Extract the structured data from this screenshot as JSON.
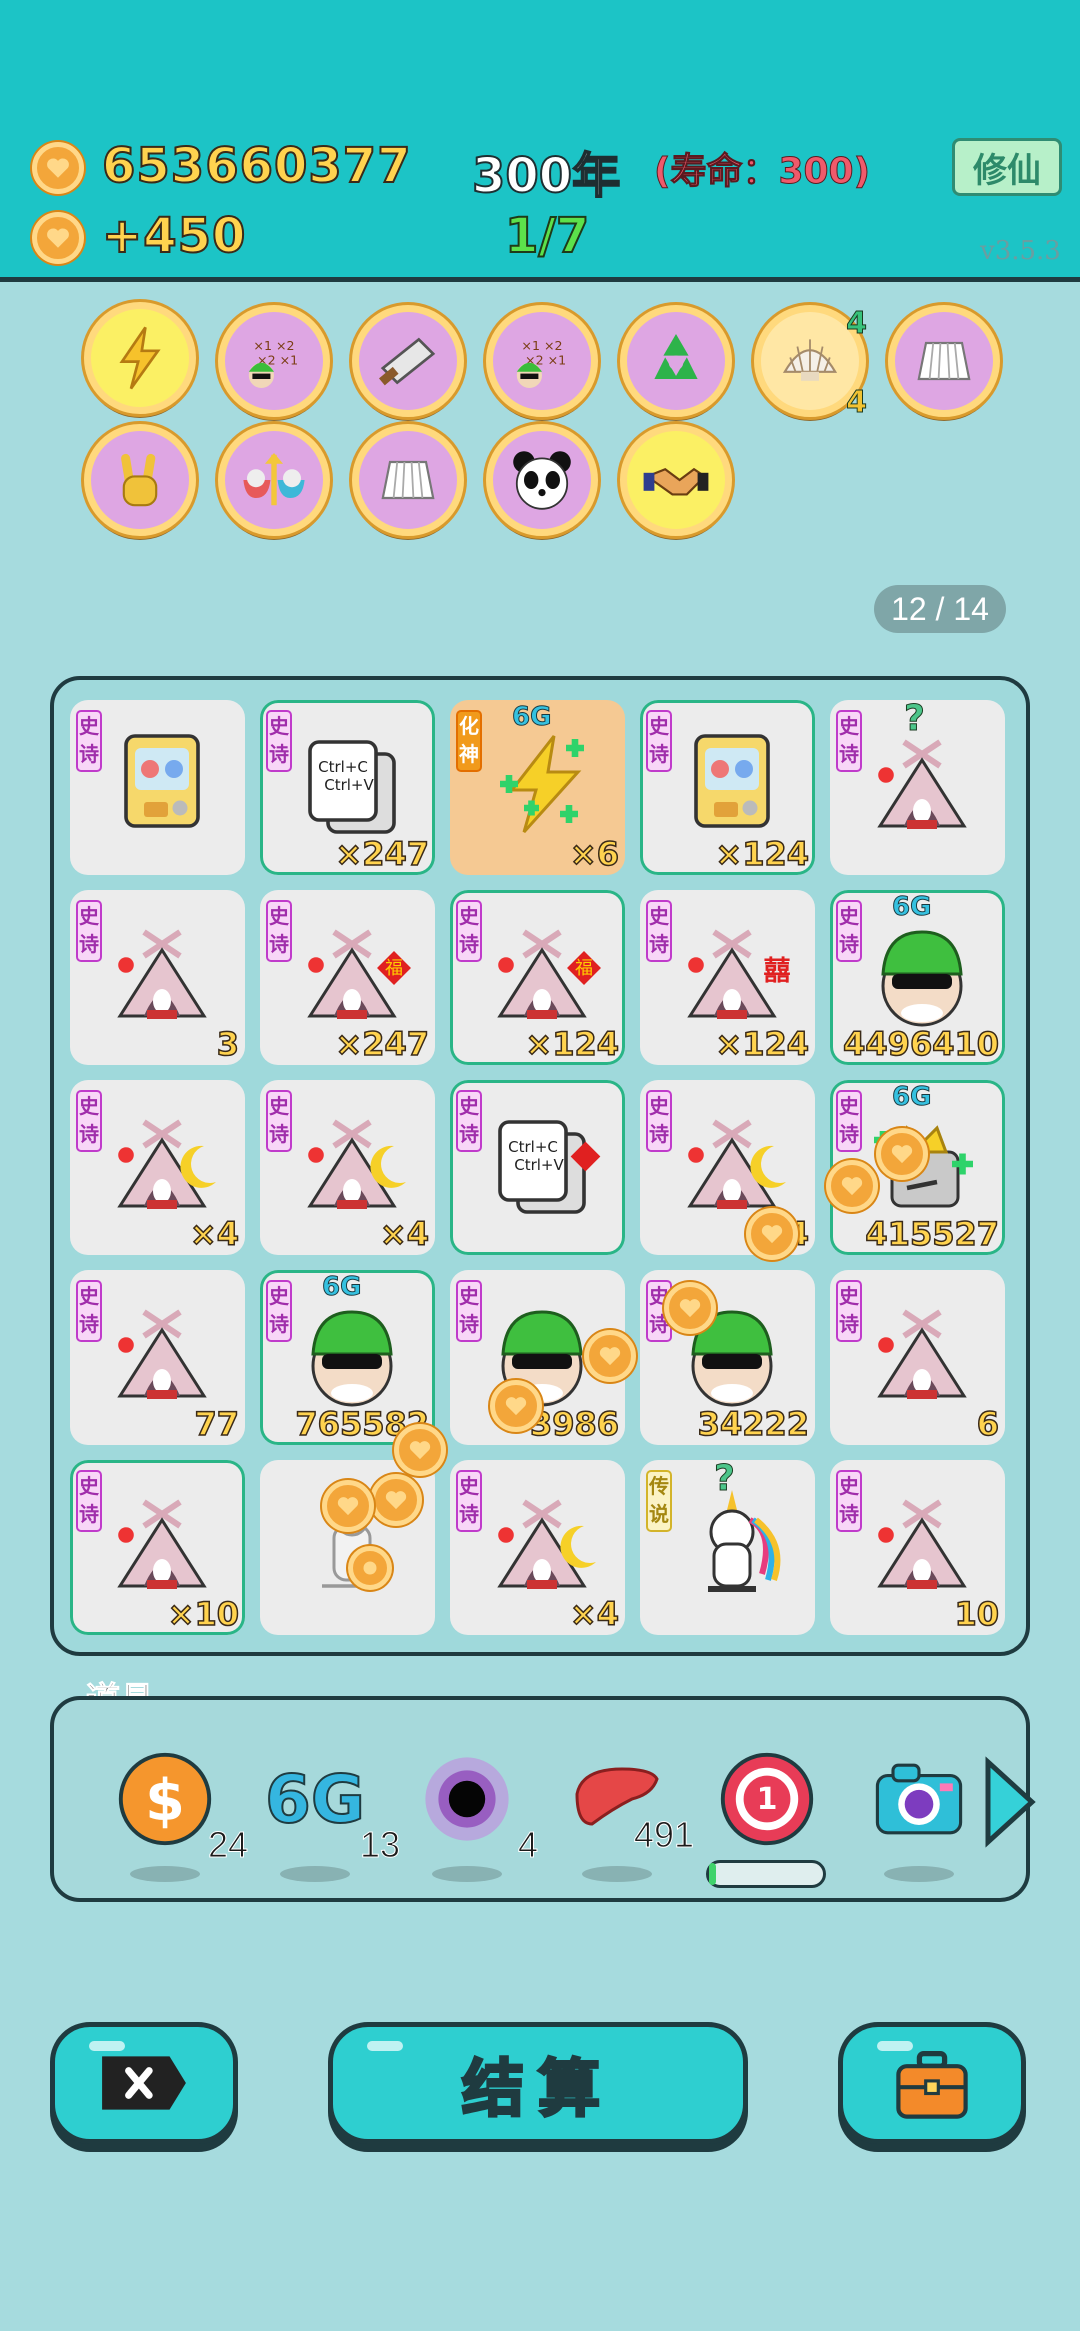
{
  "header": {
    "coins": "653660377",
    "income": "+450",
    "year": "300年",
    "lifespan": "(寿命：300)",
    "progress": "1/7",
    "cultivate_label": "修仙",
    "version": "v3.5.3"
  },
  "badges": [
    {
      "name": "lightning-icon",
      "count": ""
    },
    {
      "name": "multiply-formula-icon",
      "count": ""
    },
    {
      "name": "cleaver-icon",
      "count": ""
    },
    {
      "name": "multiply-formula-icon-2",
      "count": ""
    },
    {
      "name": "recycle-icon",
      "count": ""
    },
    {
      "name": "shell-icon",
      "count_top": "4",
      "count_bottom": "4"
    },
    {
      "name": "skirt-icon",
      "count": ""
    },
    {
      "name": "rock-hand-icon",
      "count": ""
    },
    {
      "name": "bowls-arrow-icon",
      "count": ""
    },
    {
      "name": "skirt-icon-2",
      "count": ""
    },
    {
      "name": "panda-icon",
      "count": ""
    },
    {
      "name": "handshake-icon",
      "count": ""
    }
  ],
  "page_indicator": "12 / 14",
  "board": {
    "cells": [
      {
        "tag": "史诗",
        "icon": "gashapon",
        "count": "",
        "gen": "",
        "green": false
      },
      {
        "tag": "史诗",
        "icon": "copy-paste",
        "count": "×247",
        "gen": "",
        "green": true
      },
      {
        "tag": "化神",
        "icon": "lightning-plus",
        "count": "×6",
        "gen": "6G",
        "green": false,
        "orange": true
      },
      {
        "tag": "史诗",
        "icon": "gashapon",
        "count": "×124",
        "gen": "",
        "green": true
      },
      {
        "tag": "史诗",
        "icon": "rabbit-tent",
        "count": "",
        "gen": "",
        "question": "?",
        "green": false
      },
      {
        "tag": "史诗",
        "icon": "rabbit-tent",
        "count": "3",
        "gen": "",
        "green": false
      },
      {
        "tag": "史诗",
        "icon": "rabbit-tent-fu",
        "count": "×247",
        "gen": "",
        "green": false
      },
      {
        "tag": "史诗",
        "icon": "rabbit-tent-fu",
        "count": "×124",
        "gen": "",
        "green": true
      },
      {
        "tag": "史诗",
        "icon": "rabbit-tent-xi",
        "count": "×124",
        "gen": "",
        "green": false
      },
      {
        "tag": "史诗",
        "icon": "green-hat-man",
        "count": "4496410",
        "gen": "6G",
        "green": true
      },
      {
        "tag": "史诗",
        "icon": "rabbit-tent-moon",
        "count": "×4",
        "gen": "",
        "green": false
      },
      {
        "tag": "史诗",
        "icon": "rabbit-tent-moon",
        "count": "×4",
        "gen": "",
        "green": false
      },
      {
        "tag": "史诗",
        "icon": "copy-paste-fu",
        "count": "",
        "gen": "",
        "green": true
      },
      {
        "tag": "史诗",
        "icon": "rabbit-tent-moon",
        "count": "4",
        "gen": "",
        "green": false
      },
      {
        "tag": "史诗",
        "icon": "crowned-block",
        "count": "415527",
        "gen": "6G",
        "green": true
      },
      {
        "tag": "史诗",
        "icon": "rabbit-tent",
        "count": "77",
        "gen": "",
        "green": false
      },
      {
        "tag": "史诗",
        "icon": "green-hat-man",
        "count": "765582",
        "gen": "6G",
        "green": true
      },
      {
        "tag": "史诗",
        "icon": "green-hat-man",
        "count": "3986",
        "gen": "",
        "green": false
      },
      {
        "tag": "史诗",
        "icon": "green-hat-man",
        "count": "34222",
        "gen": "",
        "green": false
      },
      {
        "tag": "史诗",
        "icon": "rabbit-tent",
        "count": "6",
        "gen": "",
        "green": false
      },
      {
        "tag": "史诗",
        "icon": "rabbit-tent",
        "count": "×10",
        "gen": "",
        "green": true
      },
      {
        "tag": "",
        "icon": "small-figure",
        "count": "",
        "gen": "",
        "green": false
      },
      {
        "tag": "史诗",
        "icon": "rabbit-tent-moon",
        "count": "×4",
        "gen": "",
        "green": false
      },
      {
        "tag": "传说",
        "icon": "unicorn",
        "count": "",
        "gen": "",
        "question": "?",
        "green": false,
        "goldtag": true
      },
      {
        "tag": "史诗",
        "icon": "rabbit-tent",
        "count": "10",
        "gen": "",
        "green": false
      }
    ]
  },
  "tools": {
    "label": "道具",
    "items": [
      {
        "name": "dollar-coin-icon",
        "count": "24"
      },
      {
        "name": "6g-icon",
        "count": "13",
        "text": "6G"
      },
      {
        "name": "black-hole-icon",
        "count": "4"
      },
      {
        "name": "liver-icon",
        "count": "491"
      },
      {
        "name": "target-one-icon",
        "count": "",
        "text": "1"
      },
      {
        "name": "camera-icon",
        "count": ""
      }
    ]
  },
  "buttons": {
    "settle_label": "结算"
  },
  "colors": {
    "header_bg": "#1cc4c6",
    "page_bg": "#a6dbde",
    "button_bg": "#2ecfd0",
    "badge_purple": "#dea6e3",
    "gold_text": "#ffd34f"
  }
}
